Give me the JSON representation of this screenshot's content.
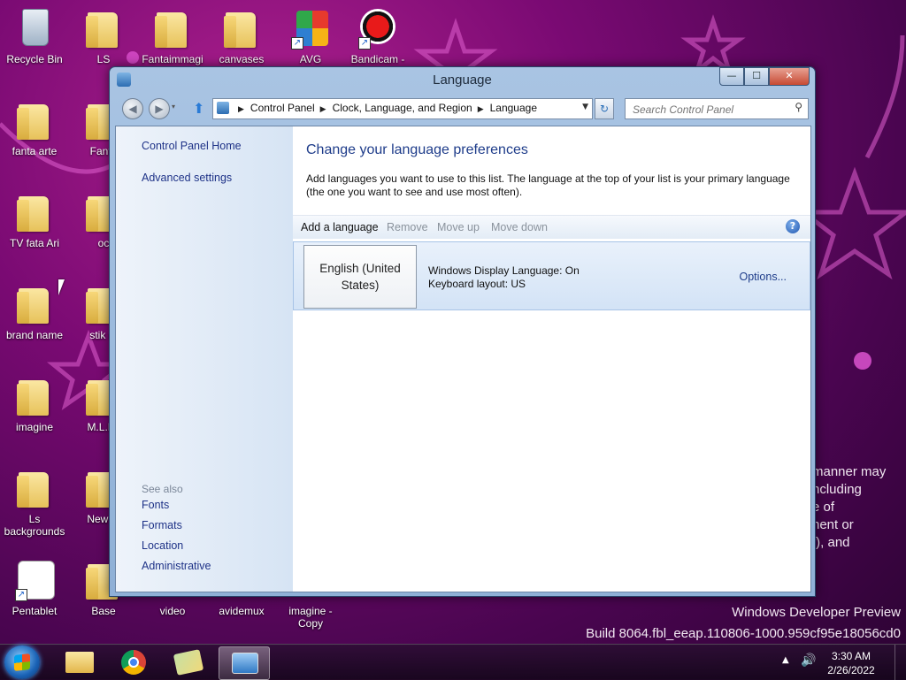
{
  "desktop": {
    "icons": [
      {
        "label": "Recycle Bin",
        "type": "recycle-bin"
      },
      {
        "label": "LS",
        "type": "folder"
      },
      {
        "label": "Fantaimmagi",
        "type": "folder"
      },
      {
        "label": "canvases",
        "type": "folder"
      },
      {
        "label": "AVG",
        "type": "app"
      },
      {
        "label": "Bandicam -",
        "type": "app"
      },
      {
        "label": "fanta arte",
        "type": "folder"
      },
      {
        "label": "Fanta",
        "type": "folder"
      },
      {
        "label": "TV  fata Ari",
        "type": "folder"
      },
      {
        "label": "oc",
        "type": "folder"
      },
      {
        "label": "brand name",
        "type": "folder"
      },
      {
        "label": "stik  m",
        "type": "folder"
      },
      {
        "label": "imagine",
        "type": "folder"
      },
      {
        "label": "M.L.P l",
        "type": "folder"
      },
      {
        "label": "Ls backgrounds",
        "type": "folder"
      },
      {
        "label": "New fo",
        "type": "folder"
      },
      {
        "label": "Pentablet",
        "type": "app"
      },
      {
        "label": "Base",
        "type": "folder"
      },
      {
        "label": "video",
        "type": "folder"
      },
      {
        "label": "avidemux",
        "type": "app"
      },
      {
        "label": "imagine - Copy",
        "type": "folder"
      }
    ],
    "wallpaper_text": [
      "manner may",
      "ncluding",
      "e of",
      "nent or",
      "f), and"
    ],
    "watermark_line1": "Windows Developer Preview",
    "watermark_line2": "Build 8064.fbl_eeap.110806-1000.959cf95e18056cd0"
  },
  "window": {
    "title": "Language",
    "controls": {
      "minimize": "—",
      "maximize": "☐",
      "close": "✕"
    },
    "nav": {
      "back_icon": "back-arrow-icon",
      "forward_icon": "forward-arrow-icon",
      "breadcrumbs": [
        "Control Panel",
        "Clock, Language, and Region",
        "Language"
      ],
      "search_placeholder": "Search Control Panel"
    },
    "left_pane": {
      "links": [
        "Control Panel Home",
        "Advanced settings"
      ],
      "see_also_label": "See also",
      "see_also": [
        "Fonts",
        "Formats",
        "Location",
        "Administrative"
      ]
    },
    "main": {
      "heading": "Change your language preferences",
      "description": "Add languages you want to use to this list. The language at the top of your list is your primary language (the one you want to see and use most often).",
      "toolbar": {
        "add": "Add a language",
        "remove": "Remove",
        "move_up": "Move up",
        "move_down": "Move down",
        "help": "?"
      },
      "language": {
        "name": "English (United States)",
        "display_language": "Windows Display Language: On",
        "keyboard_layout": "Keyboard layout: US",
        "options": "Options..."
      }
    }
  },
  "taskbar": {
    "time": "3:30 AM",
    "date": "2/26/2022",
    "pinned": [
      "file-explorer-icon",
      "chrome-icon",
      "paint-icon",
      "control-panel-icon"
    ]
  },
  "colors": {
    "wallpaper": "#7a0a73",
    "link": "#1e3287",
    "heading": "#1e3c8a"
  }
}
